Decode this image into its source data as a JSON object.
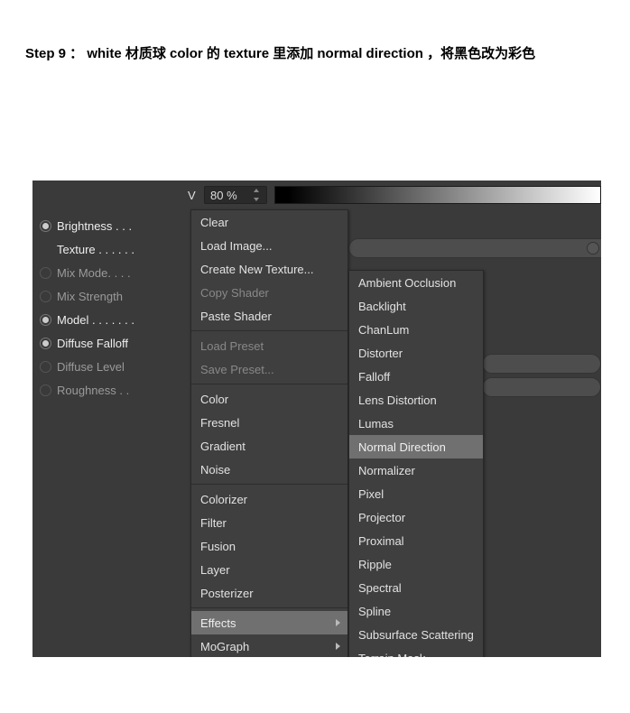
{
  "instruction": "Step 9 ： white 材质球 color 的 texture 里添加 normal direction ，将黑色改为彩色",
  "field": {
    "v_label": "V",
    "v_value": "80 %"
  },
  "sidebar": [
    {
      "label": "Brightness . . .",
      "enabled": true,
      "radio": true,
      "checked": true
    },
    {
      "label": "Texture . . . . . .",
      "enabled": true,
      "radio": false,
      "checked": false
    },
    {
      "label": "Mix Mode. . . .",
      "enabled": false,
      "radio": true,
      "checked": false
    },
    {
      "label": "Mix Strength",
      "enabled": false,
      "radio": true,
      "checked": false
    },
    {
      "label": "Model . . . . . . .",
      "enabled": true,
      "radio": true,
      "checked": true
    },
    {
      "label": "Diffuse Falloff",
      "enabled": true,
      "radio": true,
      "checked": true
    },
    {
      "label": "Diffuse Level",
      "enabled": false,
      "radio": true,
      "checked": false
    },
    {
      "label": "Roughness . .",
      "enabled": false,
      "radio": true,
      "checked": false
    }
  ],
  "menu1": {
    "groups": [
      [
        "Clear",
        "Load Image...",
        "Create New Texture...",
        "Copy Shader",
        "Paste Shader"
      ],
      [
        "Load Preset",
        "Save Preset..."
      ],
      [
        "Color",
        "Fresnel",
        "Gradient",
        "Noise"
      ],
      [
        "Colorizer",
        "Filter",
        "Fusion",
        "Layer",
        "Posterizer"
      ],
      [
        "Effects",
        "MoGraph"
      ]
    ],
    "dim": [
      "Copy Shader",
      "Load Preset",
      "Save Preset..."
    ],
    "selected": "Effects",
    "submenu": [
      "Effects",
      "MoGraph"
    ]
  },
  "menu2": {
    "items": [
      "Ambient Occlusion",
      "Backlight",
      "ChanLum",
      "Distorter",
      "Falloff",
      "Lens Distortion",
      "Lumas",
      "Normal Direction",
      "Normalizer",
      "Pixel",
      "Projector",
      "Proximal",
      "Ripple",
      "Spectral",
      "Spline",
      "Subsurface Scattering",
      "Terrain Mask"
    ],
    "selected": "Normal Direction"
  }
}
